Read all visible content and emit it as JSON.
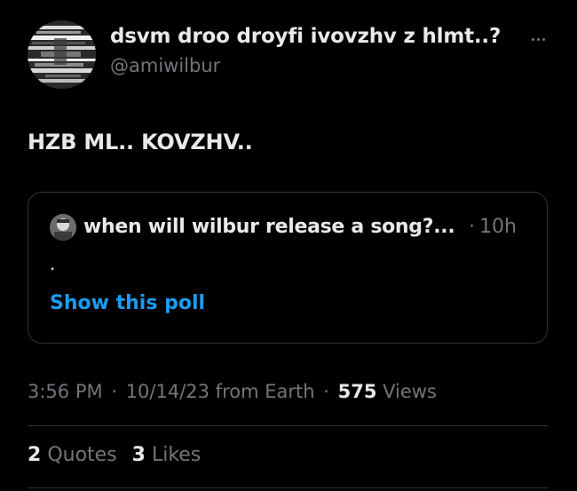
{
  "author": {
    "display_name": "dsvm droo droyfi ivovzhv z hlmt..?",
    "handle": "@amiwilbur",
    "avatar_icon": "avatar-glitch-image"
  },
  "more_icon": "more-options-icon",
  "tweet": {
    "text": "HZB ML.. KOVZHV.."
  },
  "quote": {
    "avatar_icon": "quoted-author-avatar",
    "title": "when will wilbur release a song?...",
    "separator": "·",
    "time": "10h",
    "body": ".",
    "show_poll_label": "Show this poll"
  },
  "meta": {
    "time": "3:56 PM",
    "separator": "·",
    "date": "10/14/23 from Earth",
    "views_count": "575",
    "views_label": "Views"
  },
  "stats": {
    "quotes_count": "2",
    "quotes_label": "Quotes",
    "likes_count": "3",
    "likes_label": "Likes"
  },
  "colors": {
    "background": "#000000",
    "primary_text": "#e7e9ea",
    "secondary_text": "#71767b",
    "link": "#1d9bf0",
    "border": "#2f3336"
  }
}
